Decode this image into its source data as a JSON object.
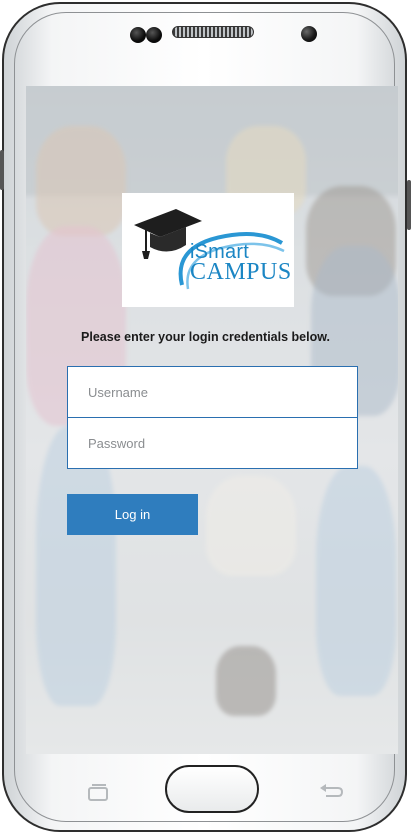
{
  "logo": {
    "line1": "iSmart",
    "line2": "CAMPUS"
  },
  "login": {
    "prompt": "Please enter your login credentials below.",
    "username_placeholder": "Username",
    "username_value": "",
    "password_placeholder": "Password",
    "password_value": "",
    "button_label": "Log in"
  },
  "colors": {
    "accent": "#2f7dbe",
    "field_border": "#2a6fb0",
    "brand": "#1b86c4"
  },
  "device_nav": {
    "icons": [
      "recent-apps-icon",
      "home-button",
      "back-icon"
    ]
  }
}
